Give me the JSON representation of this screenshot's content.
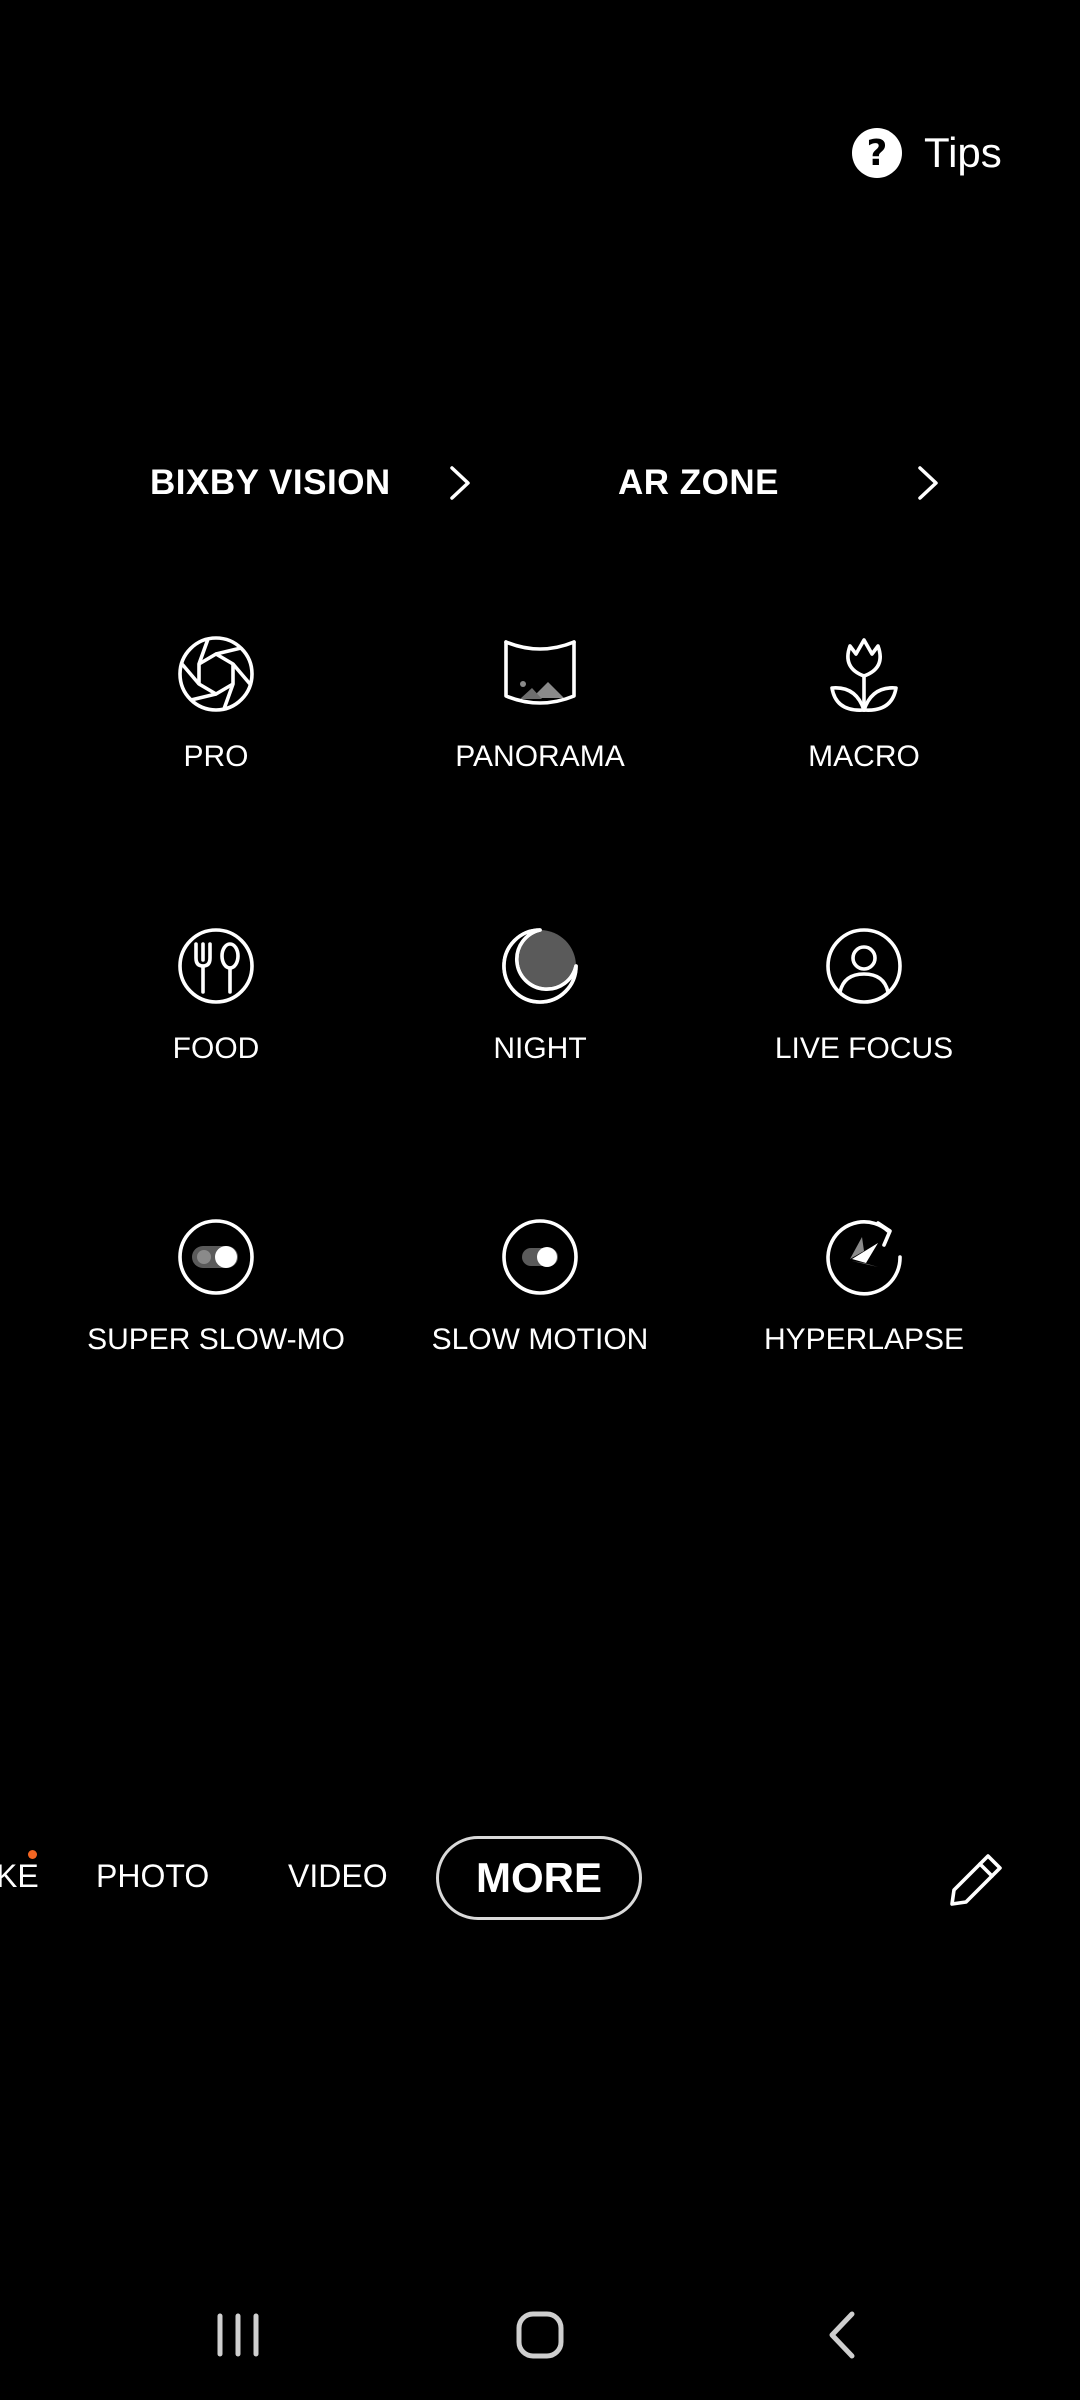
{
  "tips": {
    "icon": "help-circle-icon",
    "label": "Tips"
  },
  "links": [
    {
      "label": "BIXBY VISION",
      "icon": "chevron-right-icon"
    },
    {
      "label": "AR ZONE",
      "icon": "chevron-right-icon"
    }
  ],
  "modes": [
    {
      "label": "PRO",
      "icon": "aperture-icon"
    },
    {
      "label": "PANORAMA",
      "icon": "panorama-icon"
    },
    {
      "label": "MACRO",
      "icon": "flower-icon"
    },
    {
      "label": "FOOD",
      "icon": "fork-spoon-icon"
    },
    {
      "label": "NIGHT",
      "icon": "moon-icon"
    },
    {
      "label": "LIVE FOCUS",
      "icon": "portrait-icon"
    },
    {
      "label": "SUPER SLOW-MO",
      "icon": "super-slow-mo-icon"
    },
    {
      "label": "SLOW MOTION",
      "icon": "slow-motion-icon"
    },
    {
      "label": "HYPERLAPSE",
      "icon": "hyperlapse-icon"
    }
  ],
  "mode_bar": {
    "partial_item": "KE",
    "items": [
      "PHOTO",
      "VIDEO"
    ],
    "selected": "MORE",
    "edit_icon": "pencil-icon",
    "notification_dot_color": "#f26522"
  },
  "nav": {
    "recents_icon": "recents-icon",
    "home_icon": "home-icon",
    "back_icon": "back-icon"
  }
}
